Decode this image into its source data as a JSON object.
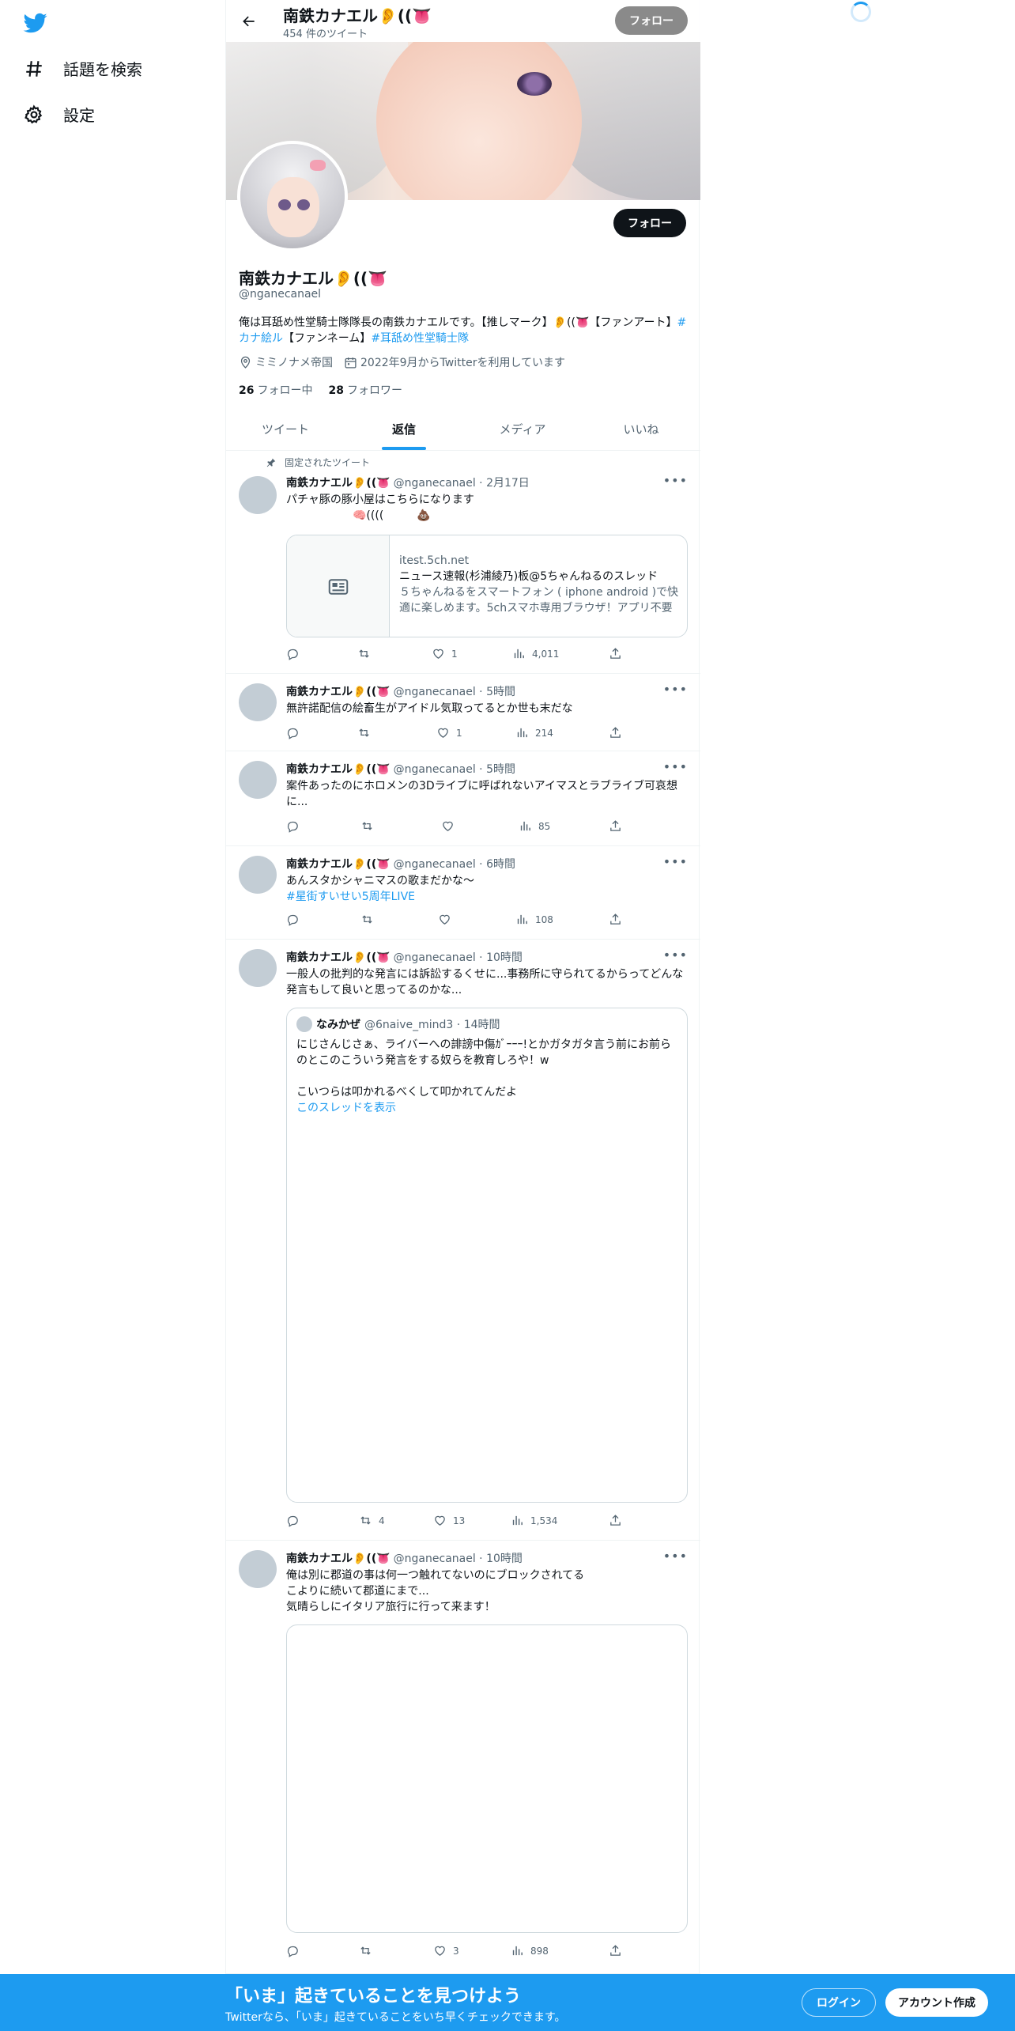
{
  "nav": {
    "explore_label": "話題を検索",
    "settings_label": "設定"
  },
  "header": {
    "name": "南鉄カナエル👂((👅",
    "tweet_count": "454 件のツイート",
    "follow_label": "フォロー"
  },
  "profile": {
    "follow_label": "フォロー",
    "name": "南鉄カナエル👂((👅",
    "handle": "@nganecanael",
    "bio_text": "俺は耳舐め性堂騎士隊隊長の南鉄カナエルです。【推しマーク】👂((👅【ファンアート】",
    "bio_tag1": "#カナ絵ル",
    "bio_mid": "【ファンネーム】",
    "bio_tag2": "#耳舐め性堂騎士隊",
    "location": "ミミノナメ帝国",
    "joined": "2022年9月からTwitterを利用しています",
    "following_count": "26",
    "following_label": "フォロー中",
    "followers_count": "28",
    "followers_label": "フォロワー"
  },
  "tabs": {
    "tweets": "ツイート",
    "replies": "返信",
    "media": "メディア",
    "likes": "いいね"
  },
  "tweets": [
    {
      "pinned_label": "固定されたツイート",
      "name": "南鉄カナエル👂((👅",
      "meta": "@nganecanael · 2月17日",
      "text": "パチャ豚の豚小屋はこちらになります\n　　　　　　🧠((((　　　💩",
      "card": {
        "domain": "itest.5ch.net",
        "title": "ニュース速報(杉浦綾乃)板@5ちゃんねるのスレッド",
        "desc": "５ちゃんねるをスマートフォン ( iphone android )で快適に楽しめます。5chスマホ専用ブラウザ！アプリ不要"
      },
      "replies": "",
      "retweets": "",
      "likes": "1",
      "views": "4,011"
    },
    {
      "name": "南鉄カナエル👂((👅",
      "meta": "@nganecanael · 5時間",
      "text": "無許諾配信の絵畜生がアイドル気取ってるとか世も末だな",
      "replies": "",
      "retweets": "",
      "likes": "1",
      "views": "214"
    },
    {
      "name": "南鉄カナエル👂((👅",
      "meta": "@nganecanael · 5時間",
      "text": "案件あったのにホロメンの3Dライブに呼ばれないアイマスとラブライブ可哀想に...",
      "replies": "",
      "retweets": "",
      "likes": "",
      "views": "85"
    },
    {
      "name": "南鉄カナエル👂((👅",
      "meta": "@nganecanael · 6時間",
      "text": "あんスタかシャニマスの歌まだかな～",
      "tag": "#星街すいせい5周年LIVE",
      "replies": "",
      "retweets": "",
      "likes": "",
      "views": "108"
    },
    {
      "name": "南鉄カナエル👂((👅",
      "meta": "@nganecanael · 10時間",
      "text": "一般人の批判的な発言には訴訟するくせに...事務所に守られてるからってどんな発言もして良いと思ってるのかな...",
      "quote": {
        "name": "なみかぜ",
        "meta": "@6naive_mind3 · 14時間",
        "text": "にじさんじさぁ、ライバーへの誹謗中傷ｶﾞｰｰｰ!とかガタガタ言う前にお前らのとこのこういう発言をする奴らを教育しろや！w\n\nこいつらは叩かれるべくして叩かれてんだよ",
        "thread_link": "このスレッドを表示"
      },
      "replies": "",
      "retweets": "4",
      "likes": "13",
      "views": "1,534"
    },
    {
      "name": "南鉄カナエル👂((👅",
      "meta": "@nganecanael · 10時間",
      "text": "俺は別に郡道の事は何一つ触れてないのにブロックされてる\nこよりに続いて郡道にまで...\n気晴らしにイタリア旅行に行って来ます！",
      "replies": "",
      "retweets": "",
      "likes": "3",
      "views": "898"
    }
  ],
  "bottom_bar": {
    "title": "「いま」起きていることを見つけよう",
    "subtitle": "Twitterなら、「いま」起きていることをいち早くチェックできます。",
    "login_label": "ログイン",
    "signup_label": "アカウント作成"
  },
  "colors": {
    "accent": "#1d9bf0",
    "text": "#0f1419",
    "secondary": "#536471"
  }
}
